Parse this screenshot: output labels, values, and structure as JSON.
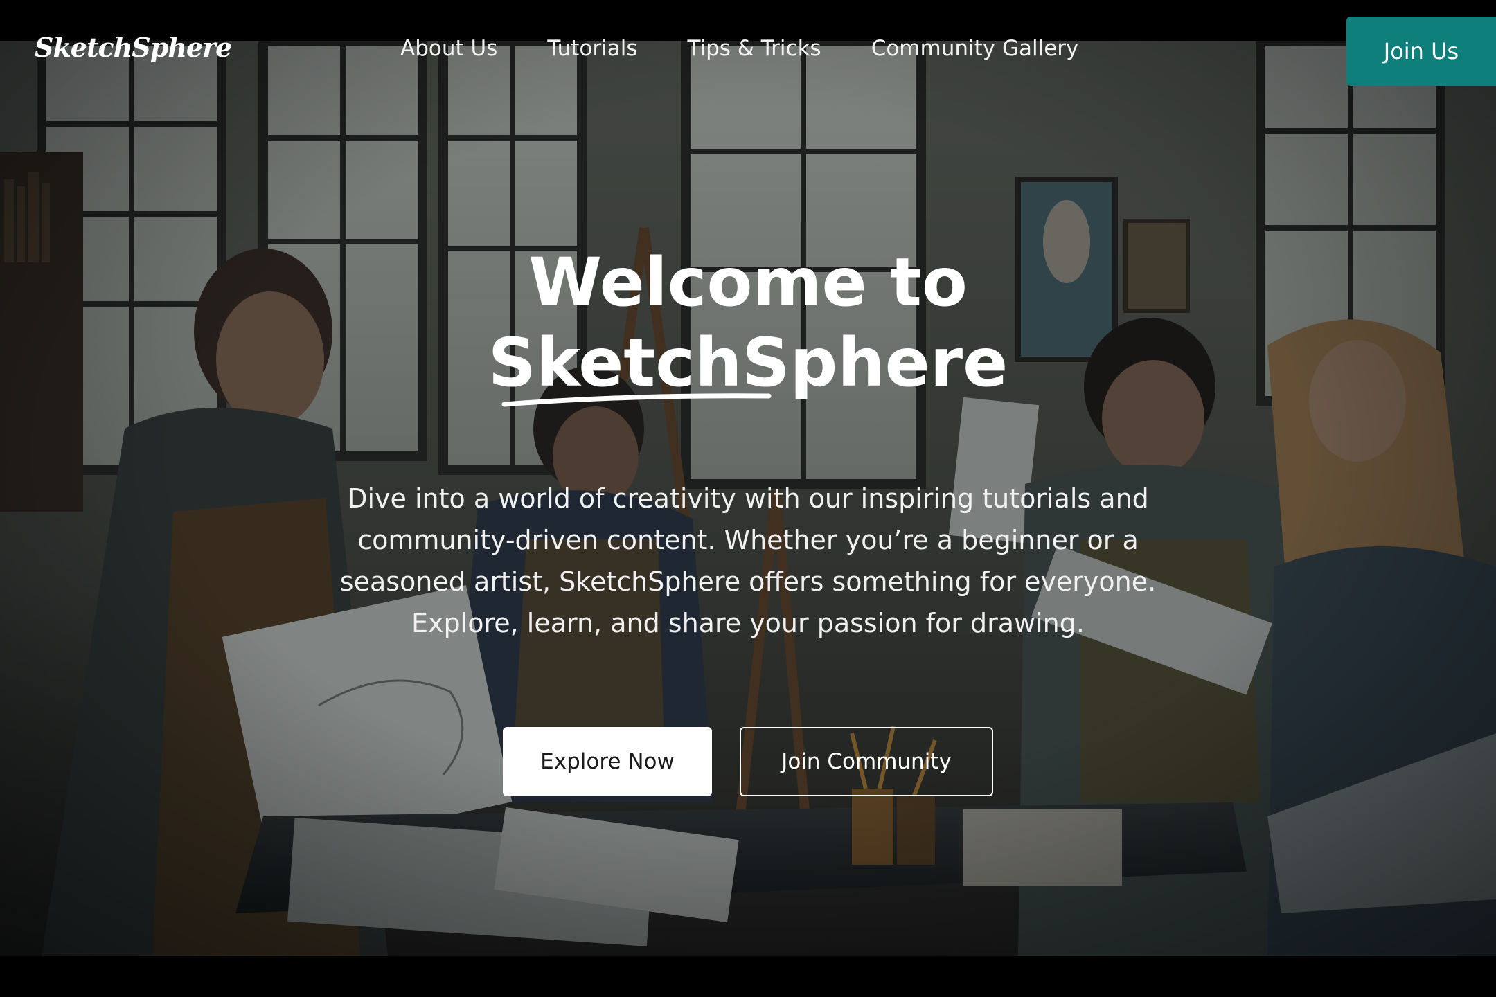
{
  "brand": {
    "logo_text": "SketchSphere",
    "accent_color": "#0e7f7b"
  },
  "nav": {
    "items": [
      {
        "label": "About Us"
      },
      {
        "label": "Tutorials"
      },
      {
        "label": "Tips & Tricks"
      },
      {
        "label": "Community Gallery"
      }
    ],
    "cta_label": "Join Us"
  },
  "hero": {
    "title_line1": "Welcome to",
    "title_line2": "SketchSphere",
    "description": "Dive into a world of creativity with our inspiring tutorials and community-driven content. Whether you’re a beginner or a seasoned artist, SketchSphere offers something for everyone. Explore, learn, and share your passion for drawing.",
    "primary_button": "Explore Now",
    "secondary_button": "Join Community"
  }
}
